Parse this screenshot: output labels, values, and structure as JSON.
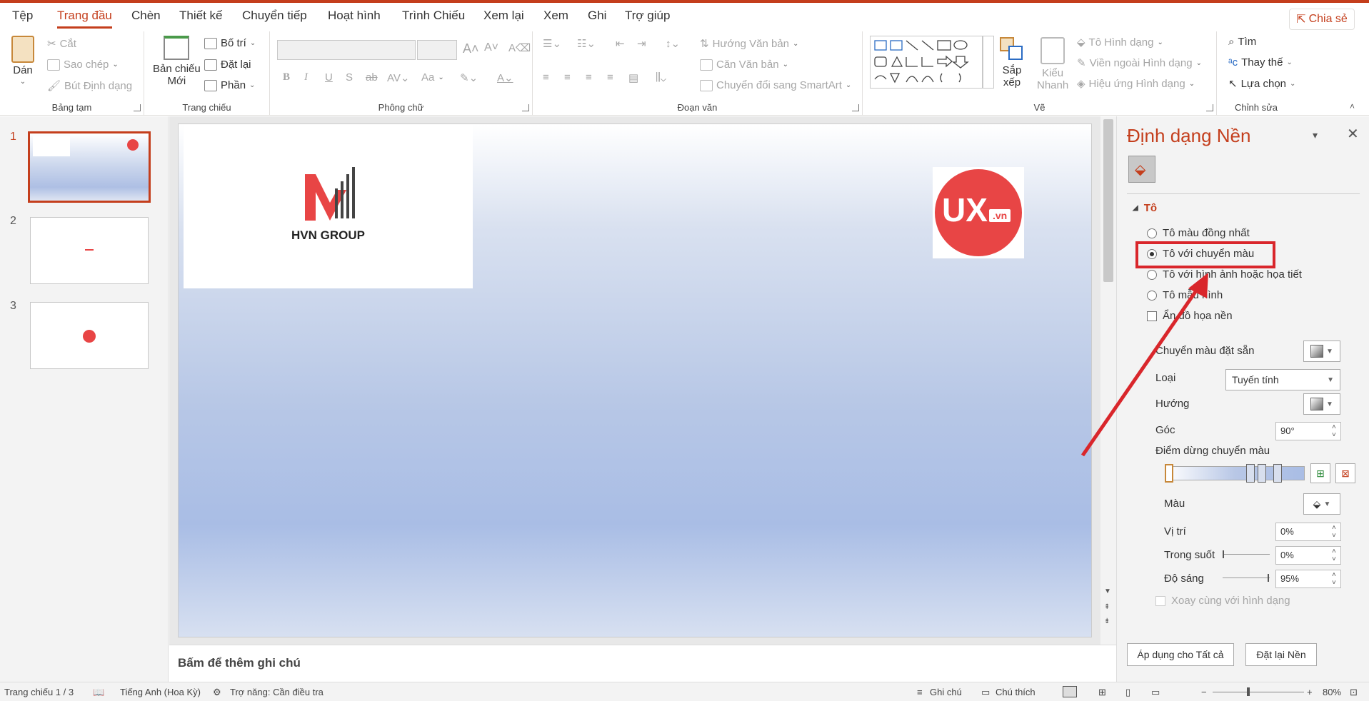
{
  "tabs": {
    "file": "Tệp",
    "home": "Trang đầu",
    "insert": "Chèn",
    "design": "Thiết kế",
    "transitions": "Chuyển tiếp",
    "animations": "Hoạt hình",
    "slideshow": "Trình Chiếu",
    "review": "Xem lại",
    "view": "Xem",
    "record": "Ghi",
    "help": "Trợ giúp",
    "share": "Chia sẻ"
  },
  "ribbon": {
    "clipboard": {
      "paste": "Dán",
      "cut": "Cắt",
      "copy": "Sao chép",
      "format_painter": "Bút Định dạng",
      "label": "Bảng tạm"
    },
    "slides": {
      "new_slide_1": "Bản chiếu",
      "new_slide_2": "Mới",
      "layout": "Bố trí",
      "reset": "Đặt lại",
      "section": "Phần",
      "label": "Trang chiếu"
    },
    "font": {
      "label": "Phông chữ",
      "bold": "B",
      "italic": "I",
      "underline": "U",
      "shadow": "S",
      "strike": "ab",
      "case": "Aa"
    },
    "paragraph": {
      "text_direction": "Hướng Văn bản",
      "align_text": "Căn Văn bản",
      "smartart": "Chuyển đổi sang SmartArt",
      "label": "Đoạn văn"
    },
    "drawing": {
      "arrange_1": "Sắp",
      "arrange_2": "xếp",
      "quick_styles_1": "Kiểu",
      "quick_styles_2": "Nhanh",
      "shape_fill": "Tô Hình dạng",
      "shape_outline": "Viền ngoài Hình dạng",
      "shape_effects": "Hiệu ứng Hình dạng",
      "label": "Vẽ"
    },
    "editing": {
      "find": "Tìm",
      "replace": "Thay thế",
      "select": "Lựa chọn",
      "label": "Chỉnh sửa"
    }
  },
  "slides": [
    {
      "num": "1"
    },
    {
      "num": "2"
    },
    {
      "num": "3"
    }
  ],
  "slide": {
    "logo_text": "HVN GROUP",
    "ux_text": "UX",
    "ux_sub": ".vn"
  },
  "notes": "Bấm để thêm ghi chú",
  "pane": {
    "title": "Định dạng Nền",
    "section": "Tô",
    "solid": "Tô màu đồng nhất",
    "gradient": "Tô với chuyển màu",
    "picture": "Tô với hình ảnh hoặc họa tiết",
    "pattern": "Tô mẫu hình",
    "hide_bg": "Ẩn đồ họa nền",
    "preset": "Chuyển màu đặt sẵn",
    "type_label": "Loại",
    "type_value": "Tuyến tính",
    "direction": "Hướng",
    "angle_label": "Góc",
    "angle_value": "90°",
    "stops_label": "Điểm dừng chuyển màu",
    "color_label": "Màu",
    "position_label": "Vị trí",
    "position_value": "0%",
    "transparency_label": "Trong suốt",
    "transparency_value": "0%",
    "brightness_label": "Độ sáng",
    "brightness_value": "95%",
    "rotate": "Xoay cùng với hình dạng",
    "apply_all": "Áp dụng cho Tất cả",
    "reset": "Đặt lại Nền"
  },
  "status": {
    "slide": "Trang chiếu 1 / 3",
    "lang": "Tiếng Anh (Hoa Kỳ)",
    "access": "Trợ năng: Cần điều tra",
    "notes": "Ghi chú",
    "comments": "Chú thích",
    "zoom": "80%"
  }
}
